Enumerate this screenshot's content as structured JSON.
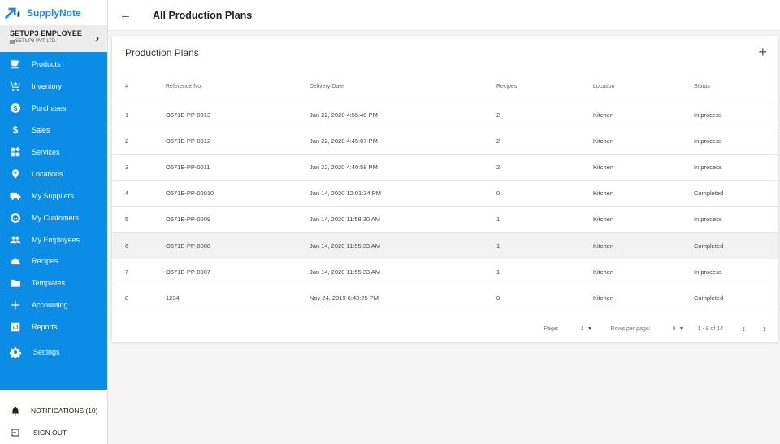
{
  "app": {
    "name": "SupplyNote"
  },
  "account": {
    "name": "SETUP3 EMPLOYEE",
    "org": "SETUP3 PVT LTD."
  },
  "sidebar": {
    "items": [
      {
        "label": "Products",
        "icon": "coffee-cup-icon"
      },
      {
        "label": "Inventory",
        "icon": "cart-plus-icon"
      },
      {
        "label": "Purchases",
        "icon": "dollar-circle-icon"
      },
      {
        "label": "Sales",
        "icon": "dollar-icon"
      },
      {
        "label": "Services",
        "icon": "widgets-icon"
      },
      {
        "label": "Locations",
        "icon": "map-pin-icon"
      },
      {
        "label": "My Suppliers",
        "icon": "truck-icon"
      },
      {
        "label": "My Customers",
        "icon": "face-icon"
      },
      {
        "label": "My Employees",
        "icon": "people-icon"
      },
      {
        "label": "Recipes",
        "icon": "cloche-icon"
      },
      {
        "label": "Templates",
        "icon": "folder-icon"
      },
      {
        "label": "Accounting",
        "icon": "plus-icon"
      },
      {
        "label": "Reports",
        "icon": "bar-chart-icon"
      },
      {
        "label": "Settings",
        "icon": "gear-icon"
      }
    ],
    "bottom": {
      "notifications": "NOTIFICATIONS (10)",
      "signout": "SIGN OUT"
    }
  },
  "header": {
    "back_icon": "arrow-left-icon",
    "title": "All Production Plans"
  },
  "card": {
    "title": "Production Plans",
    "columns": [
      "#",
      "Reference No.",
      "Delivery Date",
      "Recipes",
      "Location",
      "Status"
    ],
    "rows": [
      [
        "1",
        "O671E-PP-0013",
        "Jan 22, 2020 4:55:40 PM",
        "2",
        "Kitchen",
        "In process"
      ],
      [
        "2",
        "O671E-PP-0012",
        "Jan 22, 2020 4:45:07 PM",
        "2",
        "Kitchen",
        "In process"
      ],
      [
        "3",
        "O671E-PP-0011",
        "Jan 22, 2020 4:40:58 PM",
        "2",
        "Kitchen",
        "In process"
      ],
      [
        "4",
        "O671E-PP-00010",
        "Jan 14, 2020 12:01:34 PM",
        "0",
        "Kitchen",
        "Completed"
      ],
      [
        "5",
        "O671E-PP-0009",
        "Jan 14, 2020 11:58:30 AM",
        "1",
        "Kitchen",
        "In process"
      ],
      [
        "6",
        "O671E-PP-0008",
        "Jan 14, 2020 11:55:33 AM",
        "1",
        "Kitchen",
        "Completed"
      ],
      [
        "7",
        "O671E-PP-0007",
        "Jan 14, 2020 11:55:33 AM",
        "1",
        "Kitchen",
        "In process"
      ],
      [
        "8",
        "1234",
        "Nov 24, 2019 6:43:25 PM",
        "0",
        "Kitchen",
        "Completed"
      ]
    ],
    "highlighted_row": 6
  },
  "pagination": {
    "page_label": "Page:",
    "page_value": "1",
    "rows_label": "Rows per page:",
    "rows_value": "8",
    "range": "1 - 8 of 14"
  },
  "colors": {
    "accent": "#0b8de6",
    "brand": "#1a88e0"
  }
}
